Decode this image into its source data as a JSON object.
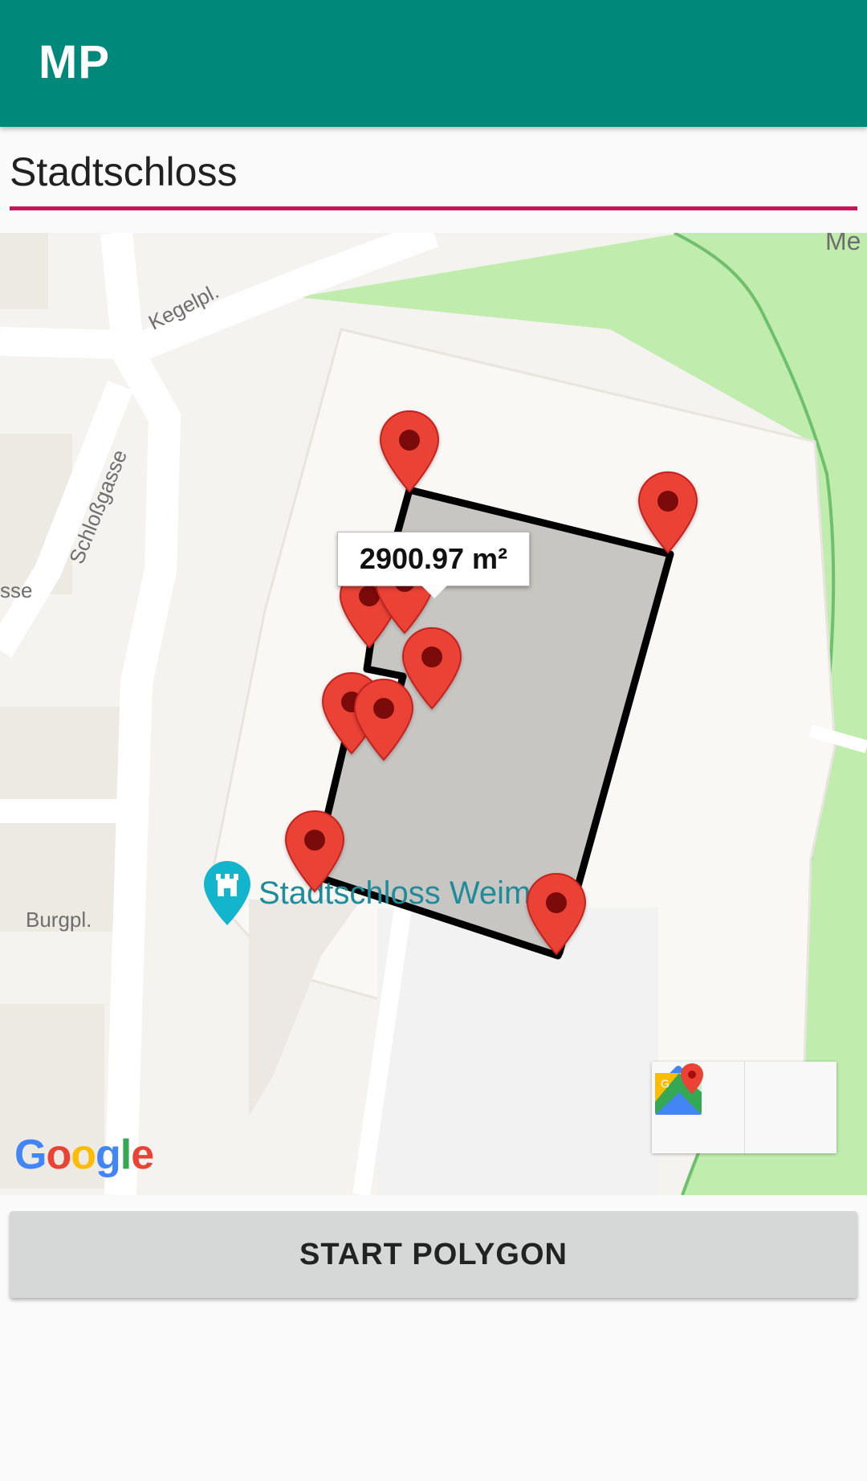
{
  "app": {
    "title": "MP"
  },
  "search": {
    "value": "Stadtschloss",
    "placeholder": ""
  },
  "map": {
    "street_labels": {
      "kegelpl": "Kegelpl.",
      "schlossgasse": "Schloßgasse",
      "sse": "sse",
      "burgpl": "Burgpl.",
      "me": "Me"
    },
    "poi": {
      "name": "Stadtschloss Weim",
      "icon": "castle-poi-icon"
    },
    "area_label": "2900.97 m²",
    "marker_count": 9,
    "attribution": "Google",
    "buttons": {
      "directions_icon": "directions-icon",
      "maps_icon": "google-maps-icon"
    }
  },
  "actions": {
    "start_polygon": "START POLYGON"
  },
  "colors": {
    "appbar": "#00897b",
    "accent": "#c2185b",
    "marker": "#ea4335",
    "polygon_fill": "#c8c6c2",
    "park": "#c0ecae"
  }
}
